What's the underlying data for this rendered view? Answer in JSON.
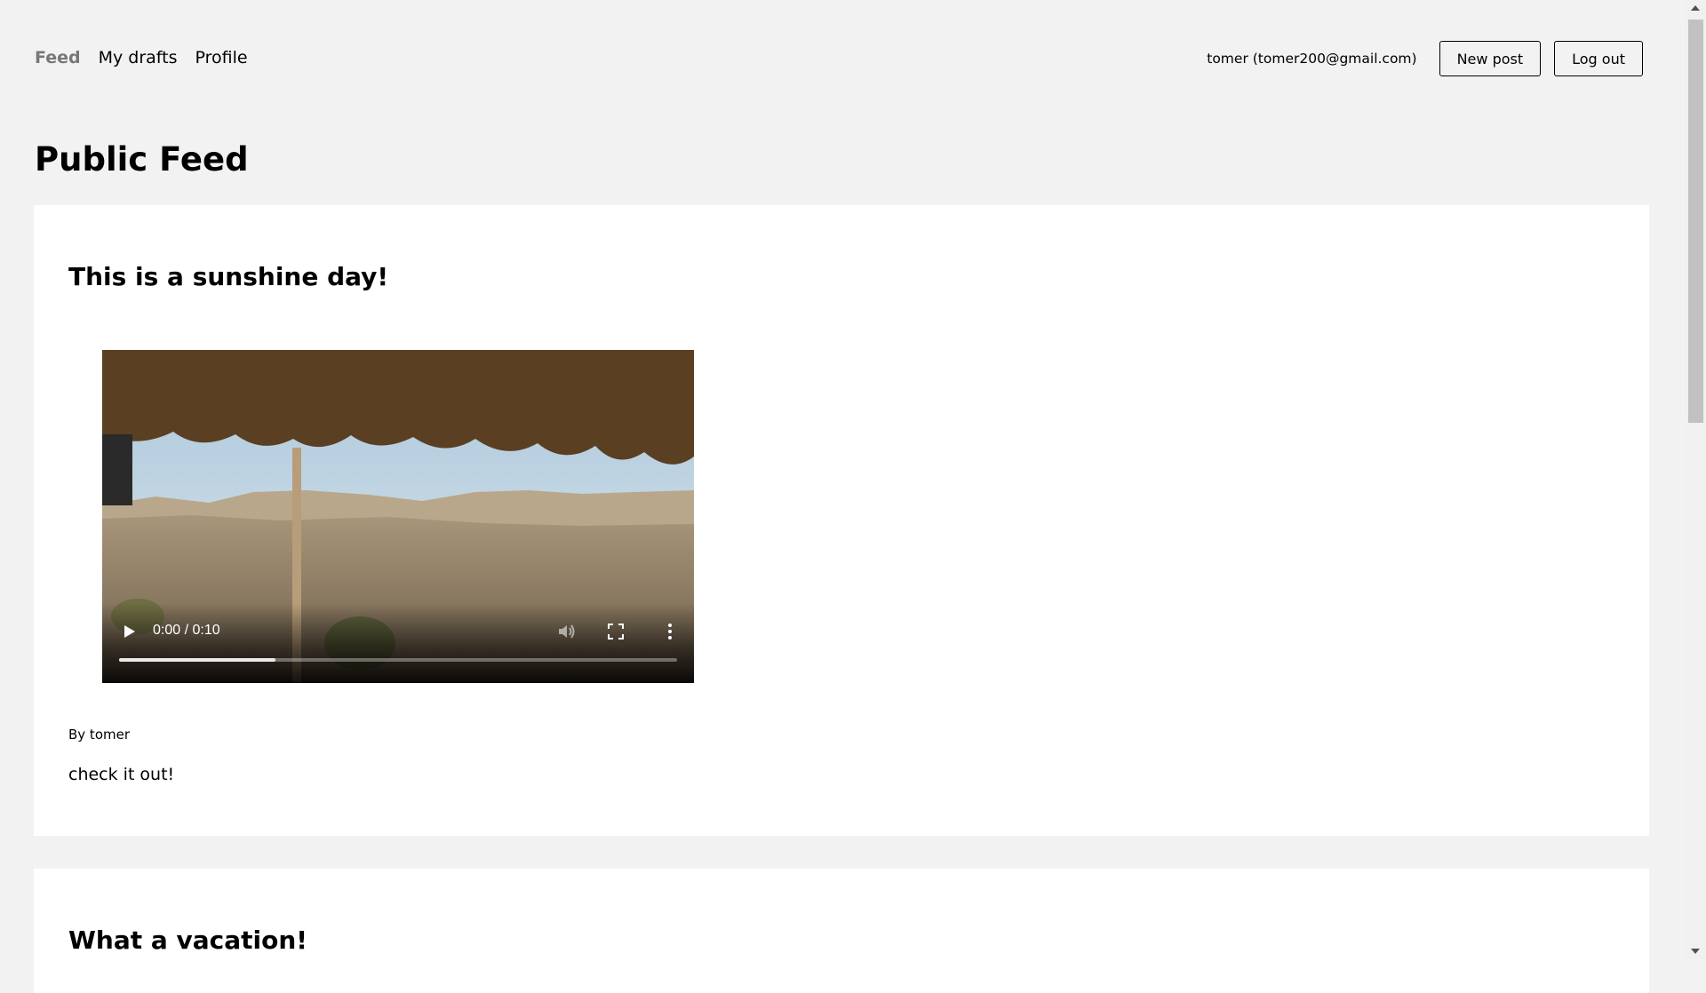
{
  "nav": {
    "links": [
      "Feed",
      "My drafts",
      "Profile"
    ],
    "user": "tomer (tomer200@gmail.com)",
    "new_post": "New post",
    "logout": "Log out"
  },
  "page": {
    "title": "Public Feed"
  },
  "posts": [
    {
      "title": "This is a sunshine day!",
      "video": {
        "time": "0:00 / 0:10",
        "progress": 0.28
      },
      "byline": "By tomer",
      "content": "check it out!"
    },
    {
      "title": "What a vacation!"
    }
  ]
}
